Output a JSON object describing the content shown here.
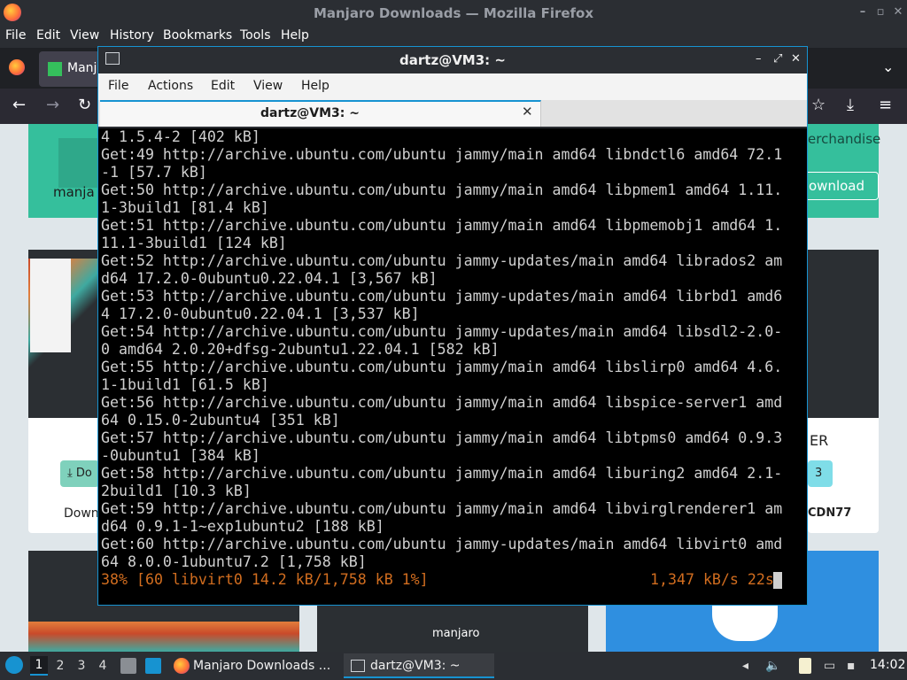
{
  "firefox": {
    "window_title": "Manjaro Downloads — Mozilla Firefox",
    "menu": [
      "File",
      "Edit",
      "View",
      "History",
      "Bookmarks",
      "Tools",
      "Help"
    ],
    "tab_label": "Manja",
    "page": {
      "logo_text": "manja",
      "merch_link": "erchandise",
      "download_button": "ownload",
      "card1_button": "Do",
      "card1_caption": "Down",
      "card3_title": "ER",
      "card3_button": "3",
      "card3_caption": "CDN77",
      "card2_logo_text": "manjaro"
    }
  },
  "terminal": {
    "window_title": "dartz@VM3: ~",
    "menu": [
      "File",
      "Actions",
      "Edit",
      "View",
      "Help"
    ],
    "tab_label": "dartz@VM3: ~",
    "output_lines": [
      "4 1.5.4-2 [402 kB]",
      "Get:49 http://archive.ubuntu.com/ubuntu jammy/main amd64 libndctl6 amd64 72.1",
      "-1 [57.7 kB]",
      "Get:50 http://archive.ubuntu.com/ubuntu jammy/main amd64 libpmem1 amd64 1.11.",
      "1-3build1 [81.4 kB]",
      "Get:51 http://archive.ubuntu.com/ubuntu jammy/main amd64 libpmemobj1 amd64 1.",
      "11.1-3build1 [124 kB]",
      "Get:52 http://archive.ubuntu.com/ubuntu jammy-updates/main amd64 librados2 am",
      "d64 17.2.0-0ubuntu0.22.04.1 [3,567 kB]",
      "Get:53 http://archive.ubuntu.com/ubuntu jammy-updates/main amd64 librbd1 amd6",
      "4 17.2.0-0ubuntu0.22.04.1 [3,537 kB]",
      "Get:54 http://archive.ubuntu.com/ubuntu jammy-updates/main amd64 libsdl2-2.0-",
      "0 amd64 2.0.20+dfsg-2ubuntu1.22.04.1 [582 kB]",
      "Get:55 http://archive.ubuntu.com/ubuntu jammy/main amd64 libslirp0 amd64 4.6.",
      "1-1build1 [61.5 kB]",
      "Get:56 http://archive.ubuntu.com/ubuntu jammy/main amd64 libspice-server1 amd",
      "64 0.15.0-2ubuntu4 [351 kB]",
      "Get:57 http://archive.ubuntu.com/ubuntu jammy/main amd64 libtpms0 amd64 0.9.3",
      "-0ubuntu1 [384 kB]",
      "Get:58 http://archive.ubuntu.com/ubuntu jammy/main amd64 liburing2 amd64 2.1-",
      "2build1 [10.3 kB]",
      "Get:59 http://archive.ubuntu.com/ubuntu jammy/main amd64 libvirglrenderer1 am",
      "d64 0.9.1-1~exp1ubuntu2 [188 kB]",
      "Get:60 http://archive.ubuntu.com/ubuntu jammy-updates/main amd64 libvirt0 amd",
      "64 8.0.0-1ubuntu7.2 [1,758 kB]"
    ],
    "progress_text": "38% [60 libvirt0 14.2 kB/1,758 kB 1%]",
    "rate_text": "1,347 kB/s 22s"
  },
  "taskbar": {
    "workspaces": [
      "1",
      "2",
      "3",
      "4"
    ],
    "tasks": [
      "Manjaro Downloads ...",
      "dartz@VM3: ~"
    ],
    "clock": "14:02"
  },
  "colors": {
    "accent": "#1793d1",
    "manjaro_green": "#35bf9c",
    "terminal_progress": "#d16d1f"
  }
}
